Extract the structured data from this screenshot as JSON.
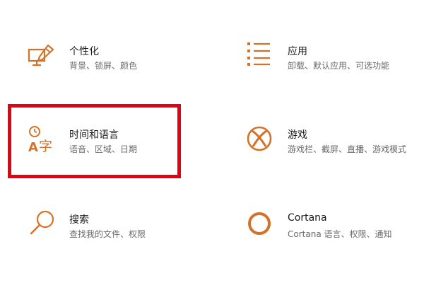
{
  "colors": {
    "accent": "#d3732a",
    "highlight": "#e50012"
  },
  "tiles": {
    "personalization": {
      "title": "个性化",
      "desc": "背景、锁屏、颜色",
      "icon": "personalization-icon"
    },
    "apps": {
      "title": "应用",
      "desc": "卸载、默认应用、可选功能",
      "icon": "apps-list-icon"
    },
    "time": {
      "title": "时间和语言",
      "desc": "语音、区域、日期",
      "icon": "time-language-icon",
      "icon_char": "字",
      "icon_letter": "A"
    },
    "gaming": {
      "title": "游戏",
      "desc": "游戏栏、截屏、直播、游戏模式",
      "icon": "xbox-icon"
    },
    "search": {
      "title": "搜索",
      "desc": "查找我的文件、权限",
      "icon": "search-icon"
    },
    "cortana": {
      "title": "Cortana",
      "desc": "Cortana 语言、权限、通知",
      "icon": "cortana-icon"
    }
  }
}
